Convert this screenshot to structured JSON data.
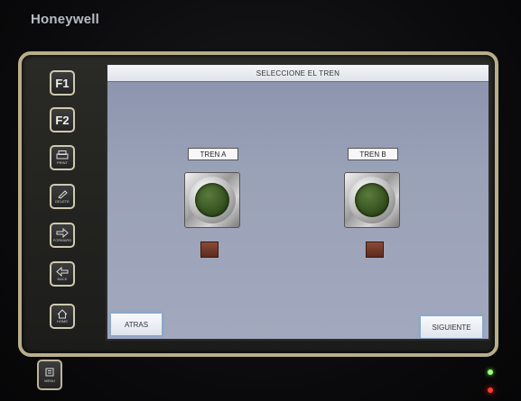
{
  "brand": "Honeywell",
  "keypad": {
    "f1_label": "F1",
    "f2_label": "F2",
    "keys": [
      {
        "icon": "print-icon",
        "caption": "PRINT"
      },
      {
        "icon": "edit-icon",
        "caption": "DELETE"
      },
      {
        "icon": "forward-icon",
        "caption": "FORWARD"
      },
      {
        "icon": "back-icon",
        "caption": "BACK"
      },
      {
        "icon": "home-icon",
        "caption": "HOME"
      }
    ],
    "menu_caption": "MENU"
  },
  "screen": {
    "title": "SELECCIONE EL TREN",
    "train_a": {
      "label": "TREN A"
    },
    "train_b": {
      "label": "TREN B"
    },
    "back_button": "ATRAS",
    "next_button": "SIGUIENTE"
  },
  "colors": {
    "lamp_green": "#35511f",
    "indicator_red": "#6a3324",
    "screen_blue": "#9aa2b8",
    "led_green": "#9cff7a",
    "led_red": "#ff3b2a"
  }
}
